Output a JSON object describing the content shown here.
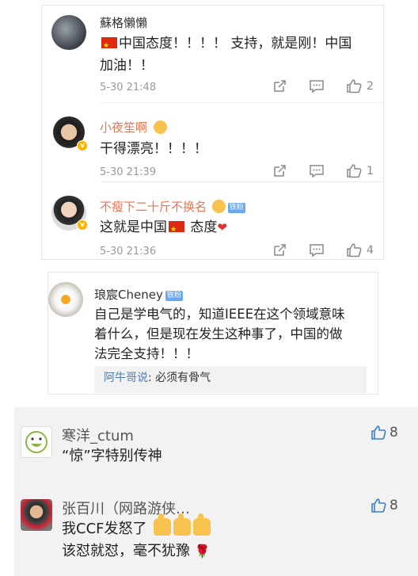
{
  "weibo_comments": [
    {
      "username": "蘇格懶懶",
      "text_line1": "中国态度！！！！ 支持，就是刚！中国",
      "text_line2": "加油！！",
      "time": "5-30 21:48",
      "likes": "2"
    },
    {
      "username": "小夜笙啊",
      "text": "干得漂亮！！！！",
      "time": "5-30 21:39",
      "likes": "1"
    },
    {
      "username": "不瘦下二十斤不换名",
      "fan_badge": "铁粉",
      "text_before": "这就是中国",
      "text_after": " 态度",
      "time": "5-30 21:36",
      "likes": "4"
    }
  ],
  "post_card": {
    "username": "琅宸Cheney",
    "fan_badge": "铁粉",
    "text_line1": "自己是学电气的，知道IEEE在这个领域意味",
    "text_line2": "着什么，但是现在发生这种事了，中国的做",
    "text_line3": "法完全支持！！！",
    "reply_user": "阿牛哥说",
    "reply_text": ": 必须有骨气"
  },
  "grey_comments": [
    {
      "username": "寒洋_ctum",
      "text": "“惊”字特别传神",
      "likes": "8"
    },
    {
      "username": "张百川（网路游侠…",
      "text_line1": "我CCF发怒了",
      "text_line2": "该怼就怼，毫不犹豫",
      "likes": "8"
    }
  ],
  "colors": {
    "orange_name": "#eb7350",
    "link_blue": "#507daf",
    "grey_bg": "#f2f2f2"
  }
}
